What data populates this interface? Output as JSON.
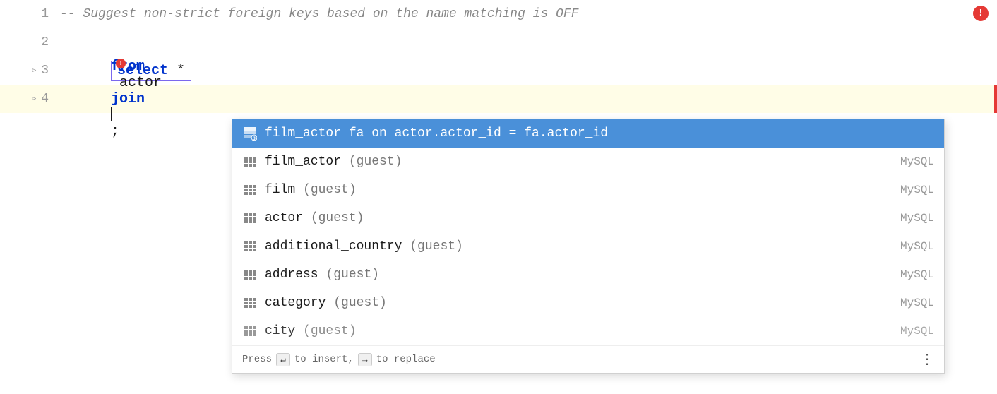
{
  "editor": {
    "lines": [
      {
        "number": 1,
        "type": "comment",
        "text": "-- Suggest non-strict foreign keys based on the name matching is OFF"
      },
      {
        "number": 2,
        "type": "empty",
        "text": ""
      },
      {
        "number": 3,
        "type": "code",
        "keyword": "select",
        "rest": " *"
      },
      {
        "number": 4,
        "type": "code",
        "keyword_from": "from",
        "rest": " actor ",
        "keyword_join": "join",
        "suffix": ";"
      }
    ]
  },
  "autocomplete": {
    "items": [
      {
        "label": "film_actor fa on actor.actor_id = fa.actor_id",
        "guest": "",
        "schema": "",
        "selected": true,
        "type": "join"
      },
      {
        "label": "film_actor",
        "guest": "(guest)",
        "schema": "MySQL",
        "selected": false,
        "type": "table"
      },
      {
        "label": "film",
        "guest": "(guest)",
        "schema": "MySQL",
        "selected": false,
        "type": "table"
      },
      {
        "label": "actor",
        "guest": "(guest)",
        "schema": "MySQL",
        "selected": false,
        "type": "table"
      },
      {
        "label": "additional_country",
        "guest": "(guest)",
        "schema": "MySQL",
        "selected": false,
        "type": "table"
      },
      {
        "label": "address",
        "guest": "(guest)",
        "schema": "MySQL",
        "selected": false,
        "type": "table"
      },
      {
        "label": "category",
        "guest": "(guest)",
        "schema": "MySQL",
        "selected": false,
        "type": "table"
      },
      {
        "label": "city",
        "guest": "(guest)",
        "schema": "MySQL",
        "selected": false,
        "type": "table",
        "partial": true
      }
    ],
    "footer": {
      "press_text": "Press",
      "enter_key": "↵",
      "to_insert": "to insert,",
      "tab_key": "→",
      "to_replace": "to replace"
    }
  },
  "error_badge": "!",
  "icons": {
    "table": "table-icon",
    "join": "join-icon",
    "dots": "⋮"
  }
}
